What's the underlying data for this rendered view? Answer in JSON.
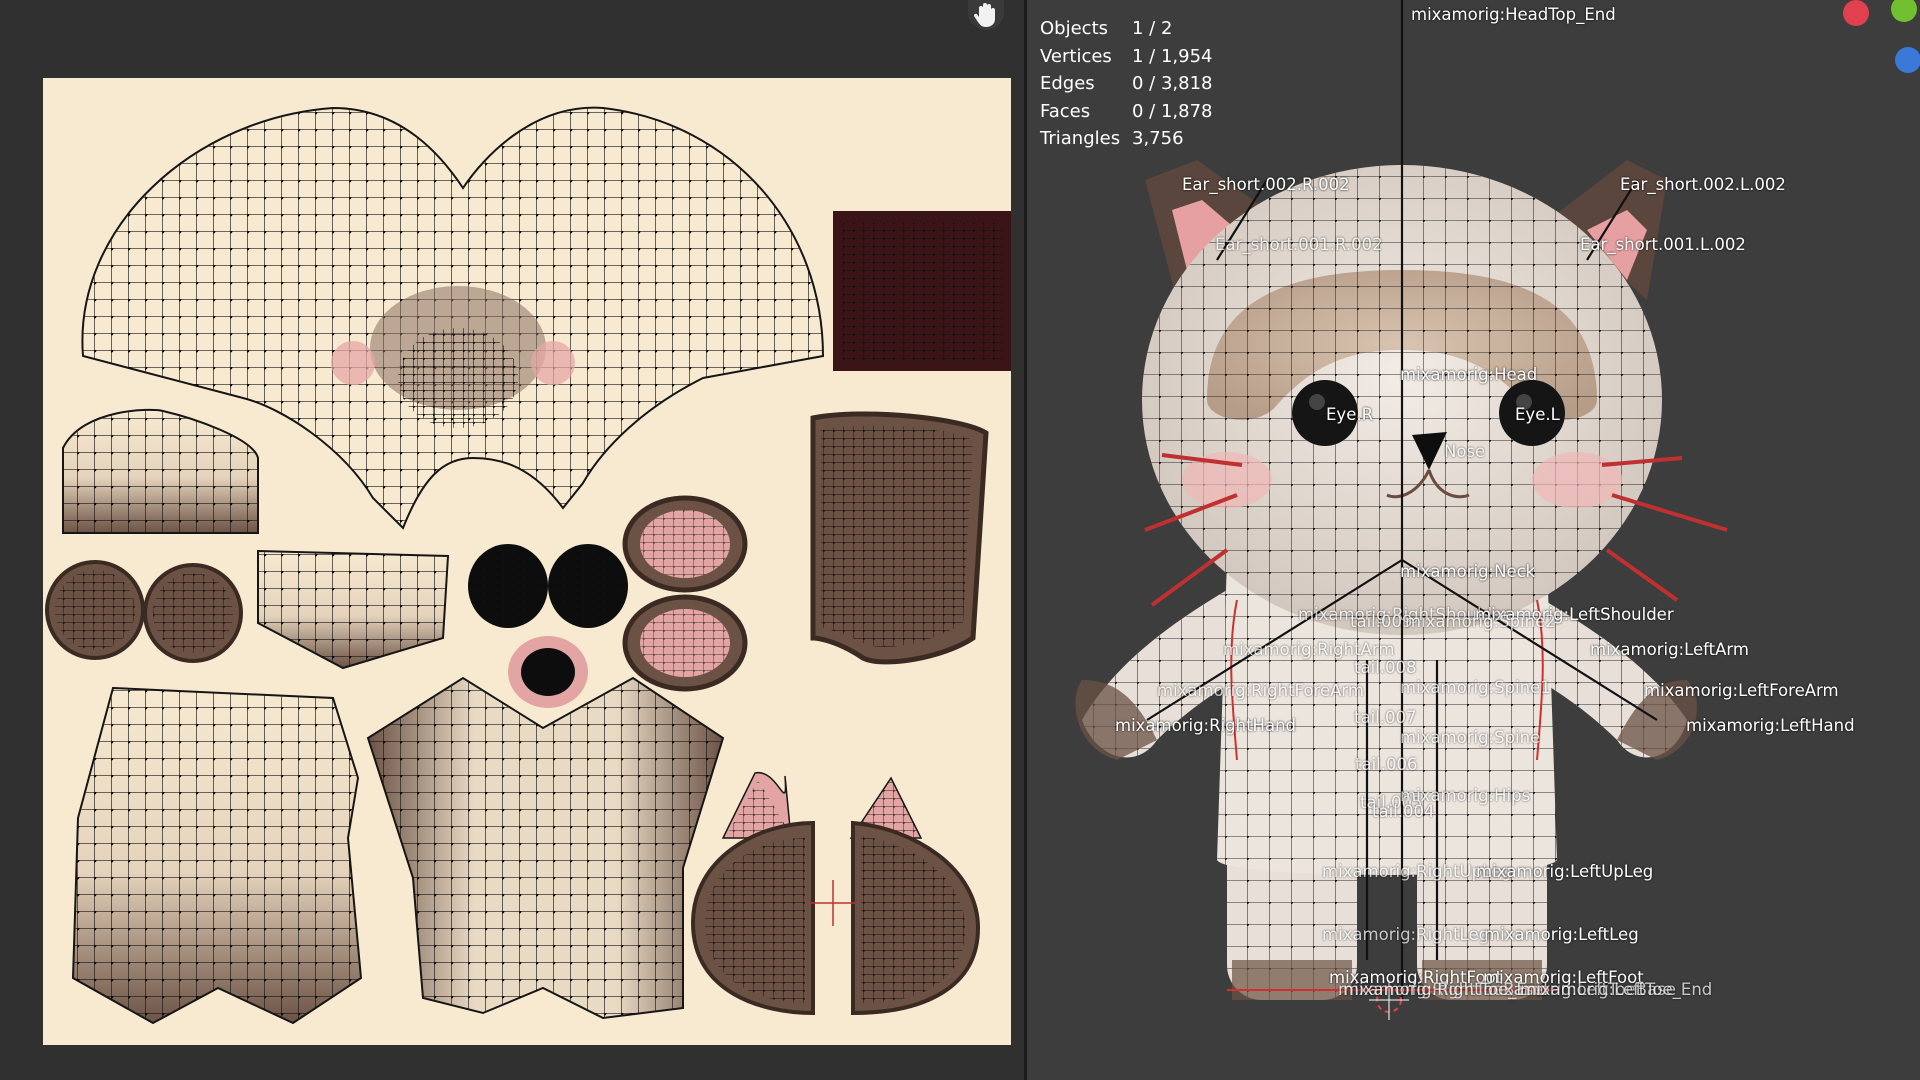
{
  "colors": {
    "uv_background": "#f7ead0",
    "viewport_background": "#3d3d3d",
    "mesh_wire": "#111111",
    "brown": "#6b5245",
    "pink": "#e4a3a4",
    "red_edge": "#d0302e"
  },
  "uv_editor": {
    "hand_icon": "hand-icon"
  },
  "stats": [
    {
      "label": "Objects",
      "value": "1 / 2"
    },
    {
      "label": "Vertices",
      "value": "1 / 1,954"
    },
    {
      "label": "Edges",
      "value": "0 / 3,818"
    },
    {
      "label": "Faces",
      "value": "0 / 1,878"
    },
    {
      "label": "Triangles",
      "value": "3,756"
    }
  ],
  "bones": [
    {
      "id": "head-top",
      "text": "mixamorig:HeadTop_End"
    },
    {
      "id": "ear-short-002-r",
      "text": "Ear_short.002.R.002"
    },
    {
      "id": "ear-short-002-l",
      "text": "Ear_short.002.L.002"
    },
    {
      "id": "ear-short-001-r",
      "text": "Ear_short.001.R.002"
    },
    {
      "id": "ear-short-001-l",
      "text": "Ear_short.001.L.002"
    },
    {
      "id": "head",
      "text": "mixamorig:Head"
    },
    {
      "id": "eye-r",
      "text": "Eye.R"
    },
    {
      "id": "eye-l",
      "text": "Eye.L"
    },
    {
      "id": "nose",
      "text": "Nose"
    },
    {
      "id": "neck",
      "text": "mixamorig:Neck"
    },
    {
      "id": "right-shoulder",
      "text": "mixamorig:RightShoulder"
    },
    {
      "id": "left-shoulder",
      "text": "mixamorig:LeftShoulder"
    },
    {
      "id": "tail-009",
      "text": "tail.009"
    },
    {
      "id": "spine2",
      "text": "mixamorig:Spine2"
    },
    {
      "id": "right-arm",
      "text": "mixamorig:RightArm"
    },
    {
      "id": "left-arm",
      "text": "mixamorig:LeftArm"
    },
    {
      "id": "tail-008",
      "text": "tail.008"
    },
    {
      "id": "spine1",
      "text": "mixamorig:Spine1"
    },
    {
      "id": "right-forearm",
      "text": "mixamorig:RightForeArm"
    },
    {
      "id": "left-forearm",
      "text": "mixamorig:LeftForeArm"
    },
    {
      "id": "right-hand",
      "text": "mixamorig:RightHand"
    },
    {
      "id": "left-hand",
      "text": "mixamorig:LeftHand"
    },
    {
      "id": "tail-007",
      "text": "tail.007"
    },
    {
      "id": "spine",
      "text": "mixamorig:Spine"
    },
    {
      "id": "tail-006",
      "text": "tail.006"
    },
    {
      "id": "tail-005",
      "text": "tail.005"
    },
    {
      "id": "hips",
      "text": "mixamorig:Hips"
    },
    {
      "id": "tail-004",
      "text": "tail.004"
    },
    {
      "id": "right-upleg",
      "text": "mixamorig:RightUpLeg"
    },
    {
      "id": "left-upleg",
      "text": "mixamorig:LeftUpLeg"
    },
    {
      "id": "right-leg",
      "text": "mixamorig:RightLeg"
    },
    {
      "id": "left-leg",
      "text": "mixamorig:LeftLeg"
    },
    {
      "id": "right-foot",
      "text": "mixamorig:RightFoot"
    },
    {
      "id": "left-foot",
      "text": "mixamorig:LeftFoot"
    },
    {
      "id": "right-toebase",
      "text": "mixamorig:RightToeBase"
    },
    {
      "id": "left-toebase",
      "text": "mixamorig:LeftToeBase"
    },
    {
      "id": "right-toe-end",
      "text": "mixamorig:RightToe_End"
    },
    {
      "id": "left-toe-end",
      "text": "mixamorig:LeftToe_End"
    }
  ],
  "gizmo": [
    {
      "axis": "X",
      "color": "#e04050"
    },
    {
      "axis": "Y",
      "color": "#70c030"
    },
    {
      "axis": "Z",
      "color": "#3b79d8"
    }
  ]
}
